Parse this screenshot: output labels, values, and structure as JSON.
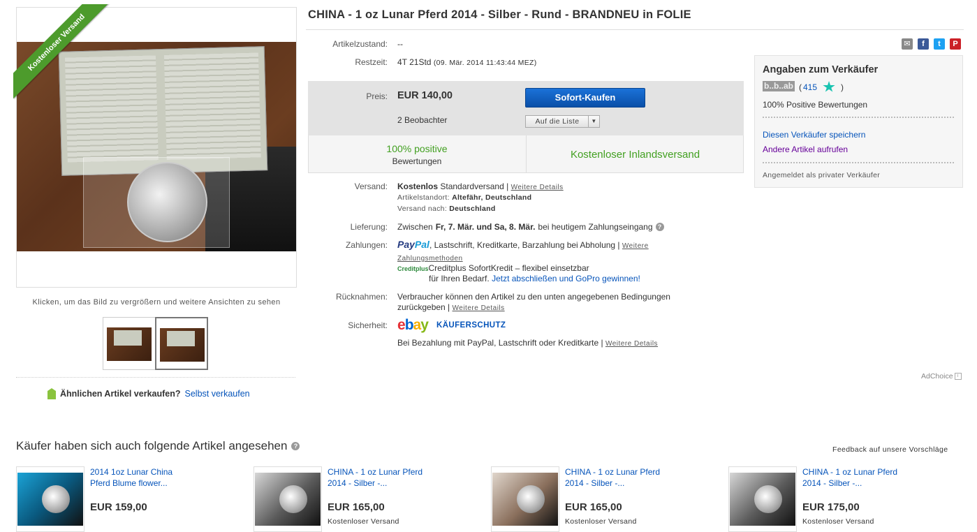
{
  "item": {
    "title": "CHINA - 1 oz Lunar Pferd 2014 - Silber - Rund - BRANDNEU in FOLIE",
    "ribbon": "Kostenloser Versand",
    "enlarge_hint": "Klicken, um das Bild zu vergrößern und weitere Ansichten zu sehen"
  },
  "sell_similar": {
    "label": "Ähnlichen Artikel verkaufen?",
    "link": "Selbst verkaufen"
  },
  "condition": {
    "label": "Artikelzustand:",
    "value": "--"
  },
  "time_left": {
    "label": "Restzeit:",
    "value": "4T 21Std",
    "end": "(09. Mär. 2014  11:43:44 MEZ)"
  },
  "price": {
    "label": "Preis:",
    "value": "EUR 140,00",
    "watchers": "2 Beobachter",
    "buy_now": "Sofort-Kaufen",
    "watchlist": "Auf die Liste"
  },
  "features": {
    "positive_title": "100% positive",
    "positive_sub": "Bewertungen",
    "free_shipping": "Kostenloser Inlandsversand"
  },
  "shipping": {
    "label": "Versand:",
    "cost": "Kostenlos",
    "method": "Standardversand |",
    "details_link": "Weitere Details",
    "location_label": "Artikelstandort:",
    "location": "Altefähr, Deutschland",
    "ships_to_label": "Versand nach:",
    "ships_to": "Deutschland"
  },
  "delivery": {
    "label": "Lieferung:",
    "prefix": "Zwischen",
    "range": "Fr, 7. Mär. und Sa, 8. Mär.",
    "suffix": "bei heutigem Zahlungseingang"
  },
  "payments": {
    "label": "Zahlungen:",
    "paypal_a": "Pay",
    "paypal_b": "Pal",
    "methods": ", Lastschrift, Kreditkarte, Barzahlung bei Abholung |",
    "more_link": "Weitere Zahlungsmethoden",
    "creditplus_logo": "Creditplus",
    "credit_line1": "Creditplus SofortKredit – flexibel einsetzbar",
    "credit_line2": "für Ihren Bedarf.",
    "credit_link": "Jetzt abschließen und GoPro gewinnen!"
  },
  "returns": {
    "label": "Rücknahmen:",
    "line1": "Verbraucher können den Artikel zu den unten angegebenen Bedingungen",
    "line2": "zurückgeben |",
    "link": "Weitere Details"
  },
  "security": {
    "label": "Sicherheit:",
    "logo_e": "e",
    "logo_b": "b",
    "logo_a": "a",
    "logo_y": "y",
    "protection": "KÄUFERSCHUTZ",
    "text": "Bei Bezahlung mit PayPal, Lastschrift oder Kreditkarte |",
    "link": "Weitere Details"
  },
  "seller": {
    "heading": "Angaben zum Verkäufer",
    "name": "b..b..ab",
    "score_open": "(",
    "score": "415",
    "score_close": ")",
    "positive": "100% Positive Bewertungen",
    "save_link": "Diesen Verkäufer speichern",
    "other_link": "Andere Artikel aufrufen",
    "private": "Angemeldet als privater Verkäufer"
  },
  "adchoice": "AdChoice",
  "recommendations": {
    "heading": "Käufer haben sich auch folgende Artikel angesehen",
    "feedback": "Feedback auf unsere Vorschläge",
    "items": [
      {
        "title": "2014 1oz Lunar China Pferd Blume flower...",
        "price": "EUR 159,00",
        "shipping": ""
      },
      {
        "title": "CHINA - 1 oz Lunar Pferd 2014 - Silber -...",
        "price": "EUR 165,00",
        "shipping": "Kostenloser Versand"
      },
      {
        "title": "CHINA - 1 oz Lunar Pferd 2014 - Silber -...",
        "price": "EUR 165,00",
        "shipping": "Kostenloser Versand"
      },
      {
        "title": "CHINA - 1 oz Lunar Pferd 2014 - Silber -...",
        "price": "EUR 175,00",
        "shipping": "Kostenloser Versand"
      }
    ]
  },
  "icons": {
    "share": [
      "email-icon",
      "facebook-icon",
      "twitter-icon",
      "pinterest-icon"
    ]
  },
  "colors": {
    "accent_blue": "#0654ba",
    "positive_green": "#42a021",
    "buy_button": "#0a4fa8",
    "ribbon": "#4d9b2c"
  }
}
